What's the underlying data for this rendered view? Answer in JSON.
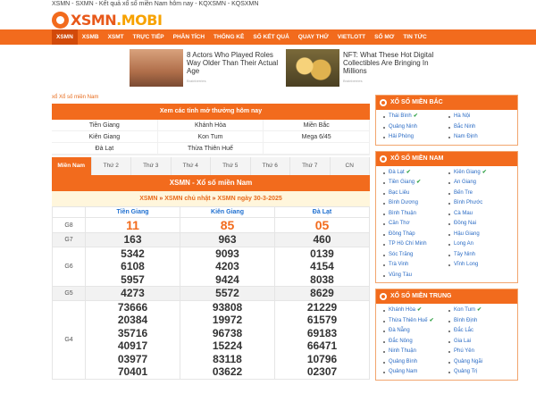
{
  "topline": "XSMN - SXMN - Kết quả xổ số miền Nam hôm nay - KQXSMN - KQSXMN",
  "logo": {
    "main": "XSMN",
    "suffix": ".MOBI"
  },
  "nav": [
    "XSMN",
    "XSMB",
    "XSMT",
    "TRỰC TIẾP",
    "PHÂN TÍCH",
    "THỐNG KÊ",
    "SỐ KẾT QUẢ",
    "QUAY THỬ",
    "VIETLOTT",
    "SỔ MƠ",
    "TIN TỨC"
  ],
  "ads": [
    {
      "text": "8 Actors Who Played Roles Way Older Than Their Actual Age",
      "source": "Brainberries"
    },
    {
      "text": "NFT: What These Hot Digital Collectibles Are Bringing In Millions",
      "source": "Brainberries"
    }
  ],
  "breadcrumb": "xổ Xổ số miền Nam",
  "today_box": {
    "title": "Xem các tỉnh mở thưởng hôm nay",
    "provinces": [
      "Tiền Giang",
      "Khánh Hòa",
      "Miền Bắc",
      "Kiên Giang",
      "Kon Tum",
      "Mega 6/45",
      "Đà Lạt",
      "Thừa Thiên Huế",
      ""
    ]
  },
  "tabs": [
    "Miền Nam",
    "Thứ 2",
    "Thứ 3",
    "Thứ 4",
    "Thứ 5",
    "Thứ 6",
    "Thứ 7",
    "CN"
  ],
  "result": {
    "title": "XSMN - Xổ số miền Nam",
    "links": [
      "XSMN",
      "XSMN chủ nhật",
      "XSMN ngày 30-3-2025"
    ],
    "provinces": [
      "Tiền Giang",
      "Kiên Giang",
      "Đà Lạt"
    ],
    "rows": [
      {
        "label": "G8",
        "values": [
          [
            "11"
          ],
          [
            "85"
          ],
          [
            "05"
          ]
        ]
      },
      {
        "label": "G7",
        "values": [
          [
            "163"
          ],
          [
            "963"
          ],
          [
            "460"
          ]
        ]
      },
      {
        "label": "G6",
        "values": [
          [
            "5342",
            "6108",
            "5957"
          ],
          [
            "9093",
            "4203",
            "9424"
          ],
          [
            "0139",
            "4154",
            "8038"
          ]
        ]
      },
      {
        "label": "G5",
        "values": [
          [
            "4273"
          ],
          [
            "5572"
          ],
          [
            "8629"
          ]
        ]
      },
      {
        "label": "G4",
        "values": [
          [
            "73666",
            "20384",
            "35716",
            "40917",
            "03977",
            "70401"
          ],
          [
            "93808",
            "19972",
            "96738",
            "15224",
            "83118",
            "03622"
          ],
          [
            "21229",
            "61579",
            "69183",
            "66471",
            "10796",
            "02307"
          ]
        ]
      }
    ]
  },
  "sidebar": [
    {
      "title": "XỔ SỐ MIỀN BẮC",
      "items": [
        {
          "label": "Thái Bình",
          "check": true
        },
        {
          "label": "Hà Nội",
          "check": false
        },
        {
          "label": "Quảng Ninh",
          "check": false
        },
        {
          "label": "Bắc Ninh",
          "check": false
        },
        {
          "label": "Hải Phòng",
          "check": false
        },
        {
          "label": "Nam Định",
          "check": false
        }
      ]
    },
    {
      "title": "XỔ SỐ MIỀN NAM",
      "items": [
        {
          "label": "Đà Lạt",
          "check": true
        },
        {
          "label": "Kiên Giang",
          "check": true
        },
        {
          "label": "Tiền Giang",
          "check": true
        },
        {
          "label": "An Giang",
          "check": false
        },
        {
          "label": "Bạc Liêu",
          "check": false
        },
        {
          "label": "Bến Tre",
          "check": false
        },
        {
          "label": "Bình Dương",
          "check": false
        },
        {
          "label": "Bình Phước",
          "check": false
        },
        {
          "label": "Bình Thuận",
          "check": false
        },
        {
          "label": "Cà Mau",
          "check": false
        },
        {
          "label": "Cần Thơ",
          "check": false
        },
        {
          "label": "Đồng Nai",
          "check": false
        },
        {
          "label": "Đồng Tháp",
          "check": false
        },
        {
          "label": "Hậu Giang",
          "check": false
        },
        {
          "label": "TP Hồ Chí Minh",
          "check": false
        },
        {
          "label": "Long An",
          "check": false
        },
        {
          "label": "Sóc Trăng",
          "check": false
        },
        {
          "label": "Tây Ninh",
          "check": false
        },
        {
          "label": "Trà Vinh",
          "check": false
        },
        {
          "label": "Vĩnh Long",
          "check": false
        },
        {
          "label": "Vũng Tàu",
          "check": false
        }
      ]
    },
    {
      "title": "XỔ SỐ MIỀN TRUNG",
      "items": [
        {
          "label": "Khánh Hòa",
          "check": true
        },
        {
          "label": "Kon Tum",
          "check": true
        },
        {
          "label": "Thừa Thiên Huế",
          "check": true
        },
        {
          "label": "Bình Định",
          "check": false
        },
        {
          "label": "Đà Nẵng",
          "check": false
        },
        {
          "label": "Đắc Lắc",
          "check": false
        },
        {
          "label": "Đắc Nông",
          "check": false
        },
        {
          "label": "Gia Lai",
          "check": false
        },
        {
          "label": "Ninh Thuận",
          "check": false
        },
        {
          "label": "Phú Yên",
          "check": false
        },
        {
          "label": "Quảng Bình",
          "check": false
        },
        {
          "label": "Quảng Ngãi",
          "check": false
        },
        {
          "label": "Quảng Nam",
          "check": false
        },
        {
          "label": "Quảng Trị",
          "check": false
        }
      ]
    }
  ],
  "colors": {
    "brand_orange": "#f26b1d",
    "link_blue": "#2a6bc4",
    "check_green": "#2ea043"
  }
}
